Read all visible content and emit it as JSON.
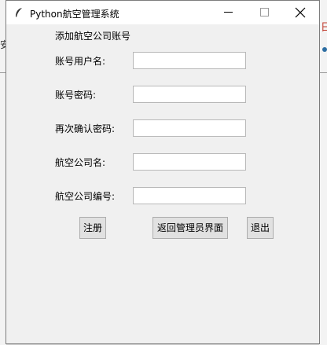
{
  "background": {
    "left_text": "安",
    "right_text": "日"
  },
  "window": {
    "title": "Python航空管理系统",
    "icon": "feather-icon"
  },
  "form": {
    "title": "添加航空公司账号",
    "fields": [
      {
        "label": "账号用户名:",
        "value": ""
      },
      {
        "label": "账号密码:",
        "value": ""
      },
      {
        "label": "再次确认密码:",
        "value": ""
      },
      {
        "label": "航空公司名:",
        "value": ""
      },
      {
        "label": "航空公司编号:",
        "value": ""
      }
    ]
  },
  "buttons": {
    "register": "注册",
    "back": "返回管理员界面",
    "exit": "退出"
  }
}
